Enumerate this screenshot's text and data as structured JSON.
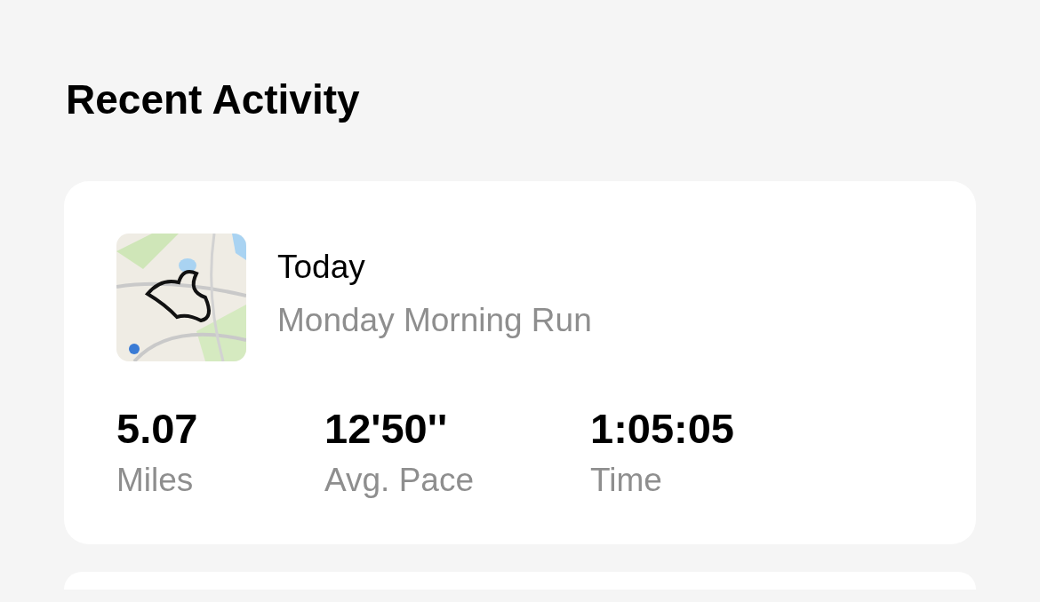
{
  "title": "Recent Activity",
  "activities": [
    {
      "date": "Today",
      "name": "Monday Morning Run",
      "stats": [
        {
          "value": "5.07",
          "label": "Miles"
        },
        {
          "value": "12'50''",
          "label": "Avg. Pace"
        },
        {
          "value": "1:05:05",
          "label": "Time"
        }
      ]
    }
  ]
}
